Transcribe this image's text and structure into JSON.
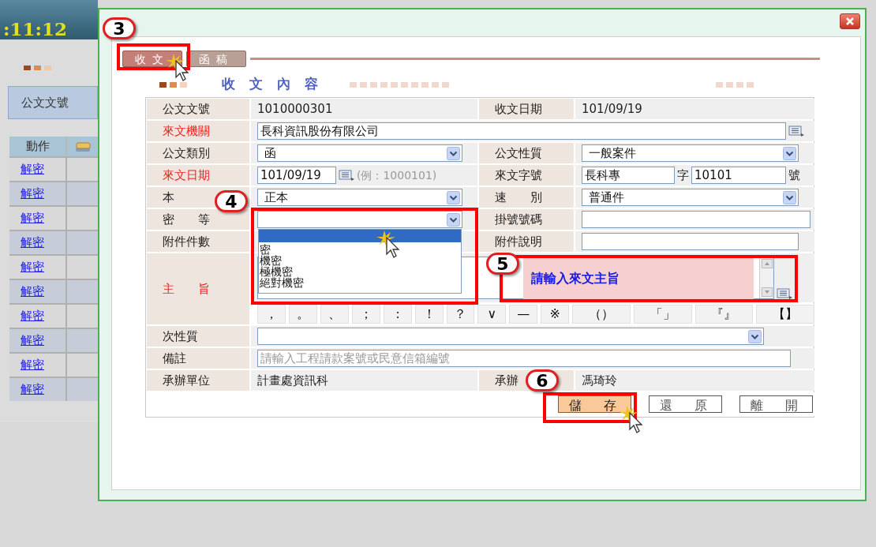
{
  "background_app": {
    "clock": ":11:12",
    "header_label": "公文文號",
    "table": {
      "columns": [
        "動作"
      ],
      "rows": [
        {
          "action": "解密"
        },
        {
          "action": "解密"
        },
        {
          "action": "解密"
        },
        {
          "action": "解密"
        },
        {
          "action": "解密"
        },
        {
          "action": "解密"
        },
        {
          "action": "解密"
        },
        {
          "action": "解密"
        },
        {
          "action": "解密"
        },
        {
          "action": "解密"
        }
      ]
    }
  },
  "dialog": {
    "tabs": [
      {
        "label": "收文",
        "selected": true
      },
      {
        "label": "函稿",
        "selected": false
      }
    ],
    "section_title": "收 文 內 容",
    "form": {
      "doc_number": {
        "label": "公文文號",
        "required": false,
        "value": "1010000301"
      },
      "receipt_date": {
        "label": "收文日期",
        "required": false,
        "value": "101/09/19"
      },
      "sender": {
        "label": "來文機關",
        "required": true,
        "value": "長科資訊股份有限公司"
      },
      "doc_type": {
        "label": "公文類別",
        "required": false,
        "value": "函"
      },
      "doc_nature": {
        "label": "公文性質",
        "required": false,
        "value": "一般案件"
      },
      "sender_date": {
        "label": "來文日期",
        "required": true,
        "value": "101/09/19",
        "hint": "(例：1000101)"
      },
      "sender_ref": {
        "label": "來文字號",
        "required": false,
        "prefix_value": "長科專",
        "word_label": "字",
        "number_value": "10101",
        "suffix": "號"
      },
      "copy_type": {
        "label": "本",
        "required": false,
        "value": "正本"
      },
      "speed": {
        "label": "速　　別",
        "required": false,
        "value": "普通件"
      },
      "secrecy": {
        "label": "密　　等",
        "required": false,
        "expanded": true,
        "options": [
          {
            "selected": true
          },
          {
            "label": "密",
            "selected": false
          },
          {
            "label": "機密",
            "selected": false
          },
          {
            "label": "極機密",
            "selected": false
          },
          {
            "label": "絕對機密",
            "selected": false
          }
        ]
      },
      "register_no": {
        "label": "掛號號碼",
        "required": false
      },
      "attachment_count": {
        "label": "附件件數",
        "required": false
      },
      "attachment_note": {
        "label": "附件說明",
        "required": false
      },
      "subject": {
        "label": "主　　旨",
        "required": true,
        "placeholder": "請輸入來文主旨"
      },
      "punctuation": [
        "，",
        "。",
        "、",
        "；",
        "：",
        "！",
        "？",
        "∨",
        "—",
        "※",
        "（）",
        "「」",
        "『』",
        "【】"
      ],
      "secondary_nature": {
        "label": "次性質",
        "required": false
      },
      "remarks": {
        "label": "備註",
        "required": false,
        "placeholder": "請輸入工程請款案號或民意信箱編號"
      },
      "department": {
        "label": "承辦單位",
        "required": false,
        "value": "計畫處資訊科"
      },
      "officer": {
        "label": "承辦",
        "required": false,
        "value": "馮琦玲"
      }
    },
    "buttons": [
      {
        "label": "儲　存",
        "highlighted": true
      },
      {
        "label": "還　原",
        "highlighted": false
      },
      {
        "label": "離　開",
        "highlighted": false
      }
    ]
  },
  "callouts": [
    {
      "number": "3"
    },
    {
      "number": "4"
    },
    {
      "number": "5"
    },
    {
      "number": "6"
    }
  ]
}
